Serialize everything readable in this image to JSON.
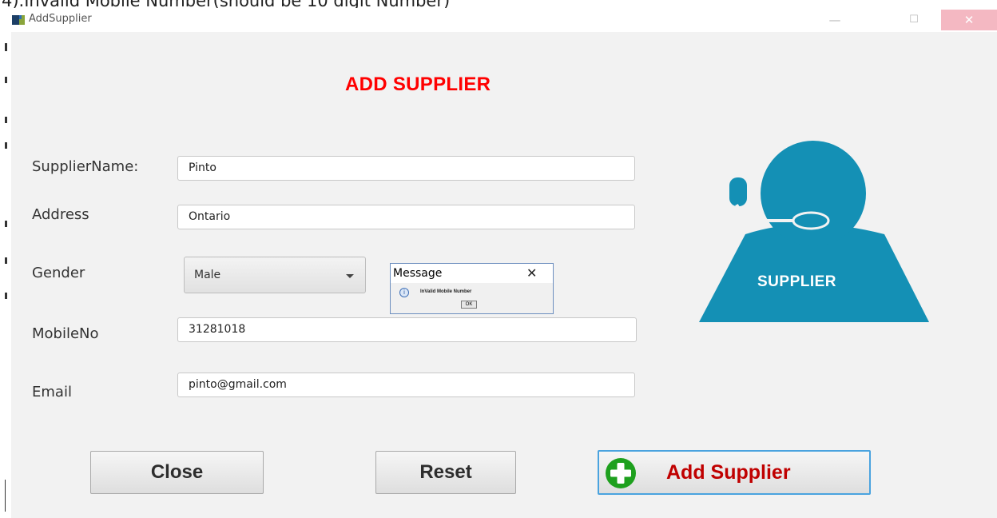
{
  "caption_text": "4).Invalid Mobile Number(should be 10 digit Number)",
  "window": {
    "title": "AddSupplier",
    "minimize_glyph": "—",
    "maximize_glyph": "☐",
    "close_glyph": "✕"
  },
  "heading": "ADD SUPPLIER",
  "form": {
    "supplier_name_label": "SupplierName:",
    "supplier_name_value": "Pinto",
    "address_label": "Address",
    "address_value": "Ontario",
    "gender_label": "Gender",
    "gender_value": "Male",
    "mobile_label": "MobileNo",
    "mobile_value": "31281018",
    "email_label": "Email",
    "email_value": "pinto@gmail.com"
  },
  "dialog": {
    "title": "Message",
    "close_glyph": "✕",
    "icon_glyph": "i",
    "message": "InValid Mobile Number",
    "ok_label": "OK"
  },
  "buttons": {
    "close_label": "Close",
    "reset_label": "Reset",
    "add_label": "Add Supplier"
  },
  "illustration": {
    "label": "SUPPLIER"
  },
  "colors": {
    "heading": "#ff0000",
    "supplier_art": "#1490b5",
    "add_button_text": "#c00000",
    "plus_green": "#1ea01e",
    "dialog_border": "#6d8fbf"
  },
  "icons": {
    "app": "app-window-icon",
    "plus": "plus-circle-icon",
    "info": "info-icon",
    "dropdown": "chevron-down-icon",
    "supplier": "headset-person-icon"
  }
}
